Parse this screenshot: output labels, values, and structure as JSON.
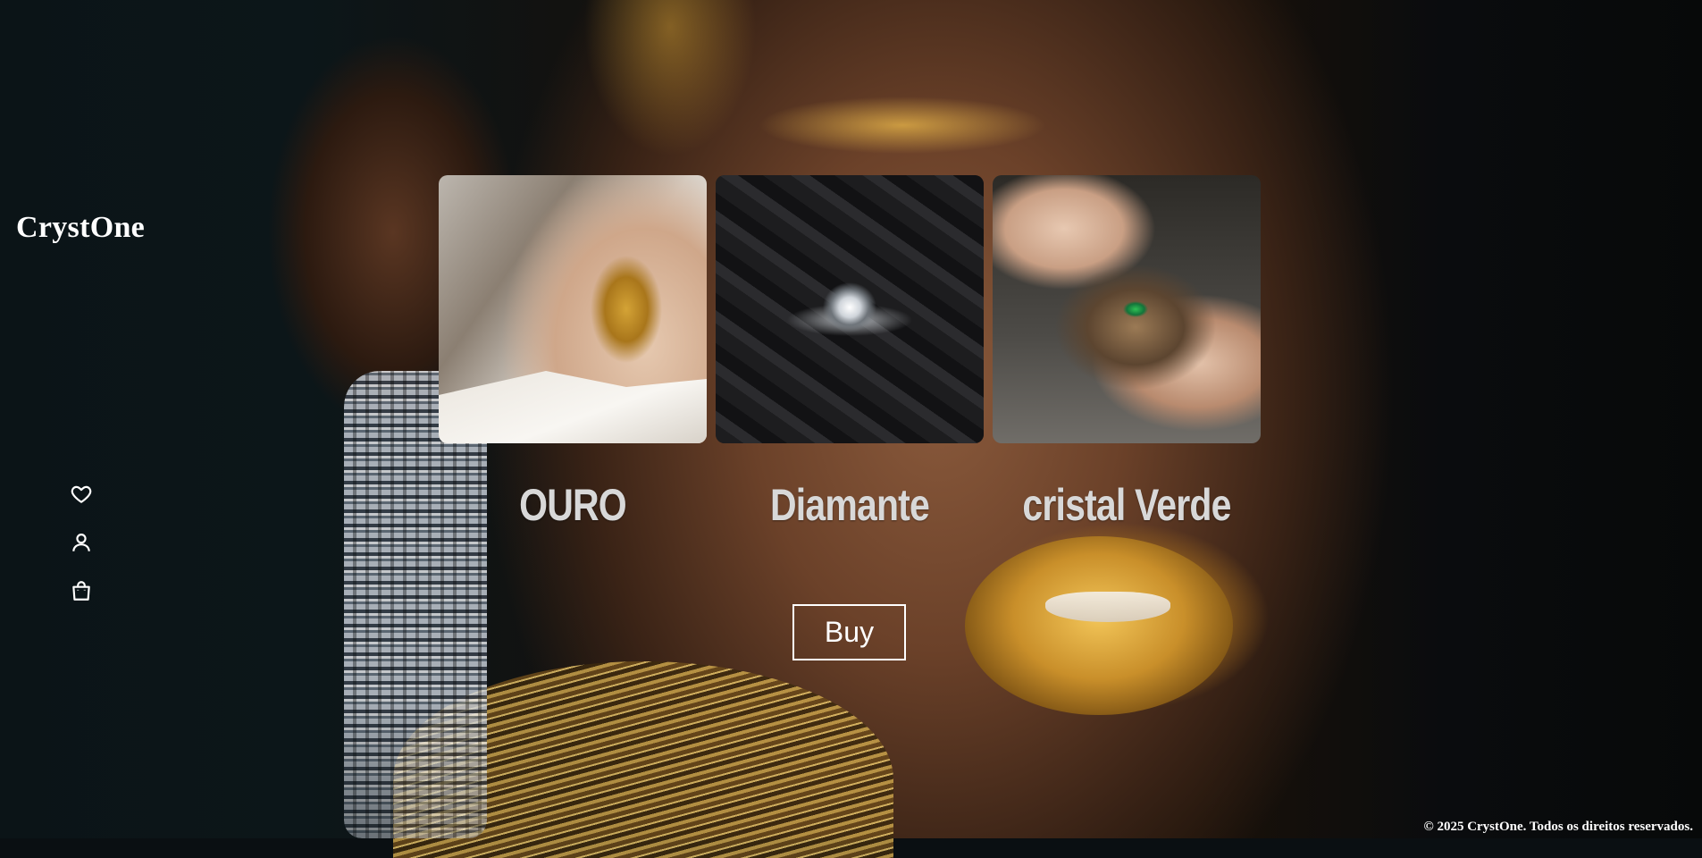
{
  "brand": {
    "name": "CrystOne"
  },
  "sidebar": {
    "icons": [
      {
        "name": "heart-icon"
      },
      {
        "name": "user-icon"
      },
      {
        "name": "shopping-bag-icon"
      }
    ]
  },
  "collections": [
    {
      "label": "OURO",
      "image": "gold-earring-photo"
    },
    {
      "label": "Diamante",
      "image": "diamond-ring-photo"
    },
    {
      "label": "cristal Verde",
      "image": "green-crystal-setting-photo"
    }
  ],
  "cta": {
    "buy_label": "Buy"
  },
  "footer": {
    "copyright": "© 2025 CrystOne. Todos os direitos reservados."
  },
  "colors": {
    "text": "#ffffff",
    "label": "#d8d8d8",
    "background": "#0a0f12",
    "gold_accent": "#d4a336"
  }
}
